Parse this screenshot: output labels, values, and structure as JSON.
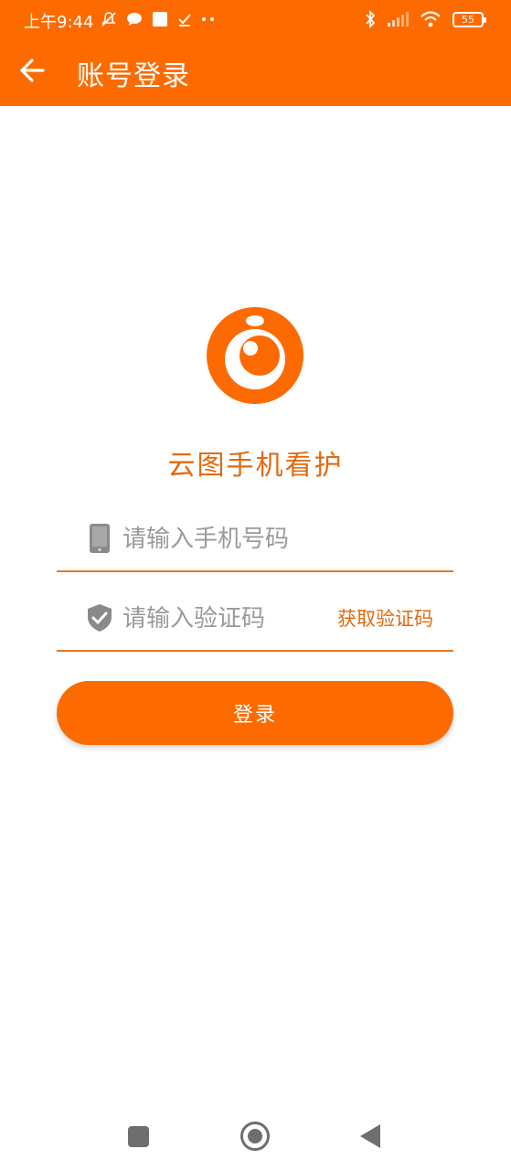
{
  "status_bar": {
    "time": "上午9:44",
    "battery": "55",
    "icons": [
      "mute-icon",
      "chat-icon",
      "gallery-icon",
      "check-icon",
      "more-dots-icon",
      "bluetooth-icon",
      "signal-icon",
      "wifi-icon",
      "battery-icon"
    ]
  },
  "header": {
    "title": "账号登录",
    "back_icon": "arrow-left-icon"
  },
  "brand": {
    "app_name": "云图手机看护",
    "logo_icon": "eye-camera-logo"
  },
  "form": {
    "phone_placeholder": "请输入手机号码",
    "phone_value": "",
    "code_placeholder": "请输入验证码",
    "code_value": "",
    "get_code_label": "获取验证码",
    "login_label": "登录"
  },
  "colors": {
    "accent": "#fd6b00",
    "accent_text": "#e26a0d",
    "placeholder": "#9a9a9a",
    "icon_gray": "#8a8a8a"
  },
  "navigation_bar": [
    "recents-icon",
    "home-icon",
    "back-triangle-icon"
  ]
}
